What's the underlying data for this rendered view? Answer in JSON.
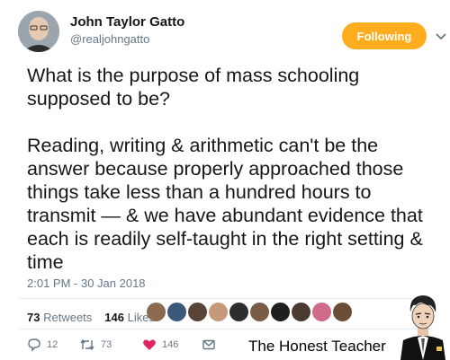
{
  "user": {
    "display_name": "John Taylor Gatto",
    "handle": "@realjohngatto",
    "follow_label": "Following"
  },
  "tweet": {
    "text": "What is the purpose of mass schooling supposed to be?\n\nReading, writing & arithmetic can't be the answer because properly approached those things take less than a hundred hours to transmit — & we have abundant evidence that each is readily self-taught in the right setting & time",
    "timestamp": "2:01 PM - 30 Jan 2018"
  },
  "stats": {
    "retweets_count": "73",
    "retweets_label": "Retweets",
    "likes_count": "146",
    "likes_label": "Likes"
  },
  "actions": {
    "reply_count": "12",
    "retweet_count": "73",
    "like_count": "146"
  },
  "watermark": {
    "text": "The Honest Teacher"
  },
  "colors": {
    "follow_button": "#ffad1f",
    "like_heart": "#e0245e",
    "muted_text": "#657786"
  },
  "icons": [
    "chevron-down-icon",
    "reply-icon",
    "retweet-icon",
    "heart-icon",
    "message-icon"
  ]
}
